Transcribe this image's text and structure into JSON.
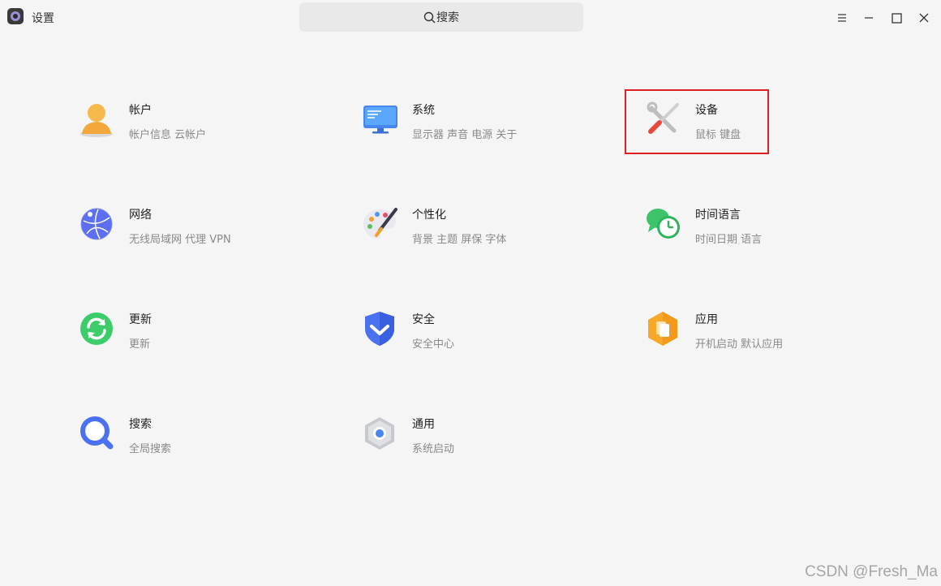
{
  "app": {
    "title": "设置"
  },
  "search": {
    "placeholder": "搜索"
  },
  "items": [
    {
      "title": "帐户",
      "subtitle": "帐户信息 云帐户",
      "icon": "account-icon"
    },
    {
      "title": "系统",
      "subtitle": "显示器 声音 电源 关于",
      "icon": "monitor-icon"
    },
    {
      "title": "设备",
      "subtitle": "鼠标 键盘",
      "icon": "tools-icon"
    },
    {
      "title": "网络",
      "subtitle": "无线局域网 代理 VPN",
      "icon": "globe-icon"
    },
    {
      "title": "个性化",
      "subtitle": "背景 主题 屏保 字体",
      "icon": "palette-icon"
    },
    {
      "title": "时间语言",
      "subtitle": "时间日期 语言",
      "icon": "clock-chat-icon"
    },
    {
      "title": "更新",
      "subtitle": "更新",
      "icon": "refresh-icon"
    },
    {
      "title": "安全",
      "subtitle": "安全中心",
      "icon": "shield-icon"
    },
    {
      "title": "应用",
      "subtitle": "开机启动 默认应用",
      "icon": "hexagon-app-icon"
    },
    {
      "title": "搜索",
      "subtitle": "全局搜索",
      "icon": "magnifier-icon"
    },
    {
      "title": "通用",
      "subtitle": "系统启动",
      "icon": "hex-nut-icon"
    }
  ],
  "watermark": "CSDN @Fresh_Ma"
}
